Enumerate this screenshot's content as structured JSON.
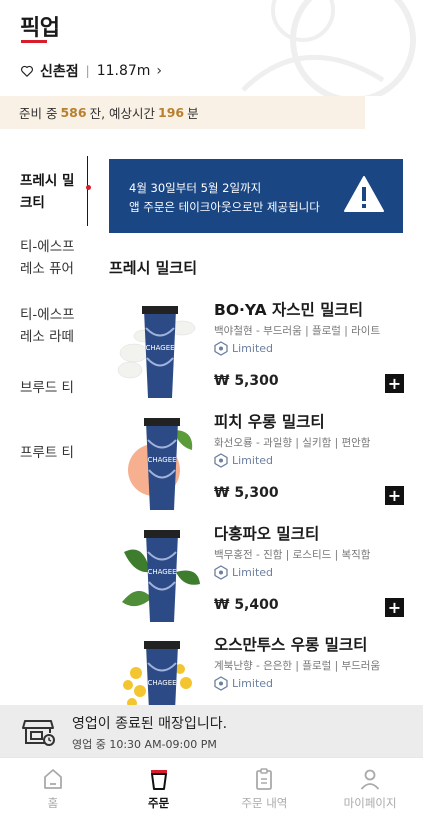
{
  "header": {
    "title": "픽업",
    "store_name": "신촌점",
    "store_distance": "11.87m"
  },
  "prep": {
    "prefix": "준비 중",
    "count": "586",
    "middle": "잔, 예상시간",
    "minutes": "196",
    "suffix": "분"
  },
  "sidebar": {
    "items": [
      {
        "label": "프레시 밀크티"
      },
      {
        "label": "티-에스프레소 퓨어"
      },
      {
        "label": "티-에스프레소 라떼"
      },
      {
        "label": "브루드 티"
      },
      {
        "label": "프루트 티"
      }
    ]
  },
  "notice": {
    "line1": "4월 30일부터 5월 2일까지",
    "line2": "앱 주문은 테이크아웃으로만 제공됩니다"
  },
  "section_title": "프레시 밀크티",
  "products": [
    {
      "name": "BO·YA 자스민 밀크티",
      "tags": "백야철현 - 부드러움 | 플로럴 | 라이트",
      "badge": "Limited",
      "price": "₩ 5,300"
    },
    {
      "name": "피치 우롱 밀크티",
      "tags": "화선오룡 - 과일향 | 실키함 | 편안함",
      "badge": "Limited",
      "price": "₩ 5,300"
    },
    {
      "name": "다홍파오 밀크티",
      "tags": "백무홍전 - 진함 | 로스티드 | 복직함",
      "badge": "Limited",
      "price": "₩ 5,400"
    },
    {
      "name": "오스만투스 우롱 밀크티",
      "tags": "계북난향 - 은은한 | 플로럴 | 부드러움",
      "badge": "Limited",
      "price": ""
    }
  ],
  "closed_bar": {
    "title": "영업이 종료된 매장입니다.",
    "hours": "영업 중 10:30 AM-09:00 PM"
  },
  "nav": {
    "home": "홈",
    "order": "주문",
    "history": "주문 내역",
    "mypage": "마이페이지"
  },
  "colors": {
    "accent_red": "#d81e2c",
    "notice_blue": "#1a4684",
    "prep_highlight": "#b7802e"
  }
}
